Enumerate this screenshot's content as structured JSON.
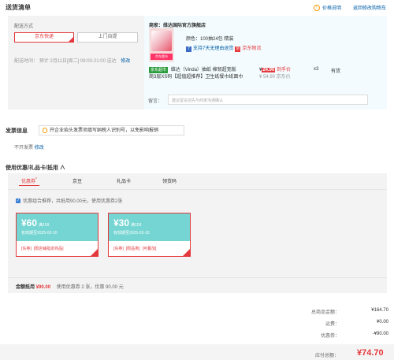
{
  "header": {
    "title": "送货清单",
    "price_note": "价格说明",
    "back_to_cart": "返回修改购物车"
  },
  "delivery": {
    "label": "配送方式",
    "options": [
      "京东快递",
      "上门自提"
    ],
    "selected": 0,
    "time_label": "配送时间：",
    "time_value": "预计 2月11日[周二] 09:00-21:00 送达",
    "modify": "修改"
  },
  "merchant": {
    "label": "商家：",
    "name": "维达国际官方旗舰店"
  },
  "product": {
    "spec": "颜色：100抽24包 精装",
    "service": "支持7天无理由退货",
    "logistics": "京东物流",
    "badge": "京东超市",
    "title_line1": "维达（Vinda）抽纸 棉韧超宽版",
    "title_line2": "商3层XS码【超值超推荐】卫生纸餐巾纸面巾",
    "price_prefix": "¥",
    "price_value": "24.90",
    "price_note": "到手价",
    "old_price": "¥ 54.90 京东价",
    "qty": "x3",
    "stock": "有货",
    "image_tag": "京东超市"
  },
  "note": {
    "label": "留言：",
    "placeholder": "建议留言前先与商家沟通确认"
  },
  "invoice": {
    "title": "发票信息",
    "tip": "开企业抬头发票须填写纳税人识别号，以免影响报销",
    "type": "不开发票",
    "modify": "修改"
  },
  "discount": {
    "title": "使用优惠/礼品卡/抵用",
    "tabs": [
      "优惠券",
      "京豆",
      "礼品卡",
      "领货码"
    ],
    "selected_tab": 0,
    "auto_text": "优惠组合推荐，共抵用90.00元，使用优惠券2张",
    "coupons": [
      {
        "amount": "¥60",
        "cond": "满159",
        "date": "有效期至2025-02-10",
        "tags": [
          "[东券]",
          "[限店铺指定商品]"
        ]
      },
      {
        "amount": "¥30",
        "cond": "满159",
        "date": "有效期至2025-02-10",
        "tags": [
          "[东券]",
          "[限品类]",
          "[可叠加]"
        ]
      }
    ],
    "summary_label": "金额抵用",
    "summary_amount": "¥90.00",
    "summary_detail": "使用优惠券 2 张，优惠 90.00 元"
  },
  "totals": {
    "rows": [
      {
        "label": "总商品金额：",
        "value": "¥164.70"
      },
      {
        "label": "运费：",
        "value": "¥0.00"
      },
      {
        "label": "优惠券：",
        "value": "-¥90.00"
      }
    ],
    "payable_label": "应付总额：",
    "payable_value": "¥74.70"
  }
}
